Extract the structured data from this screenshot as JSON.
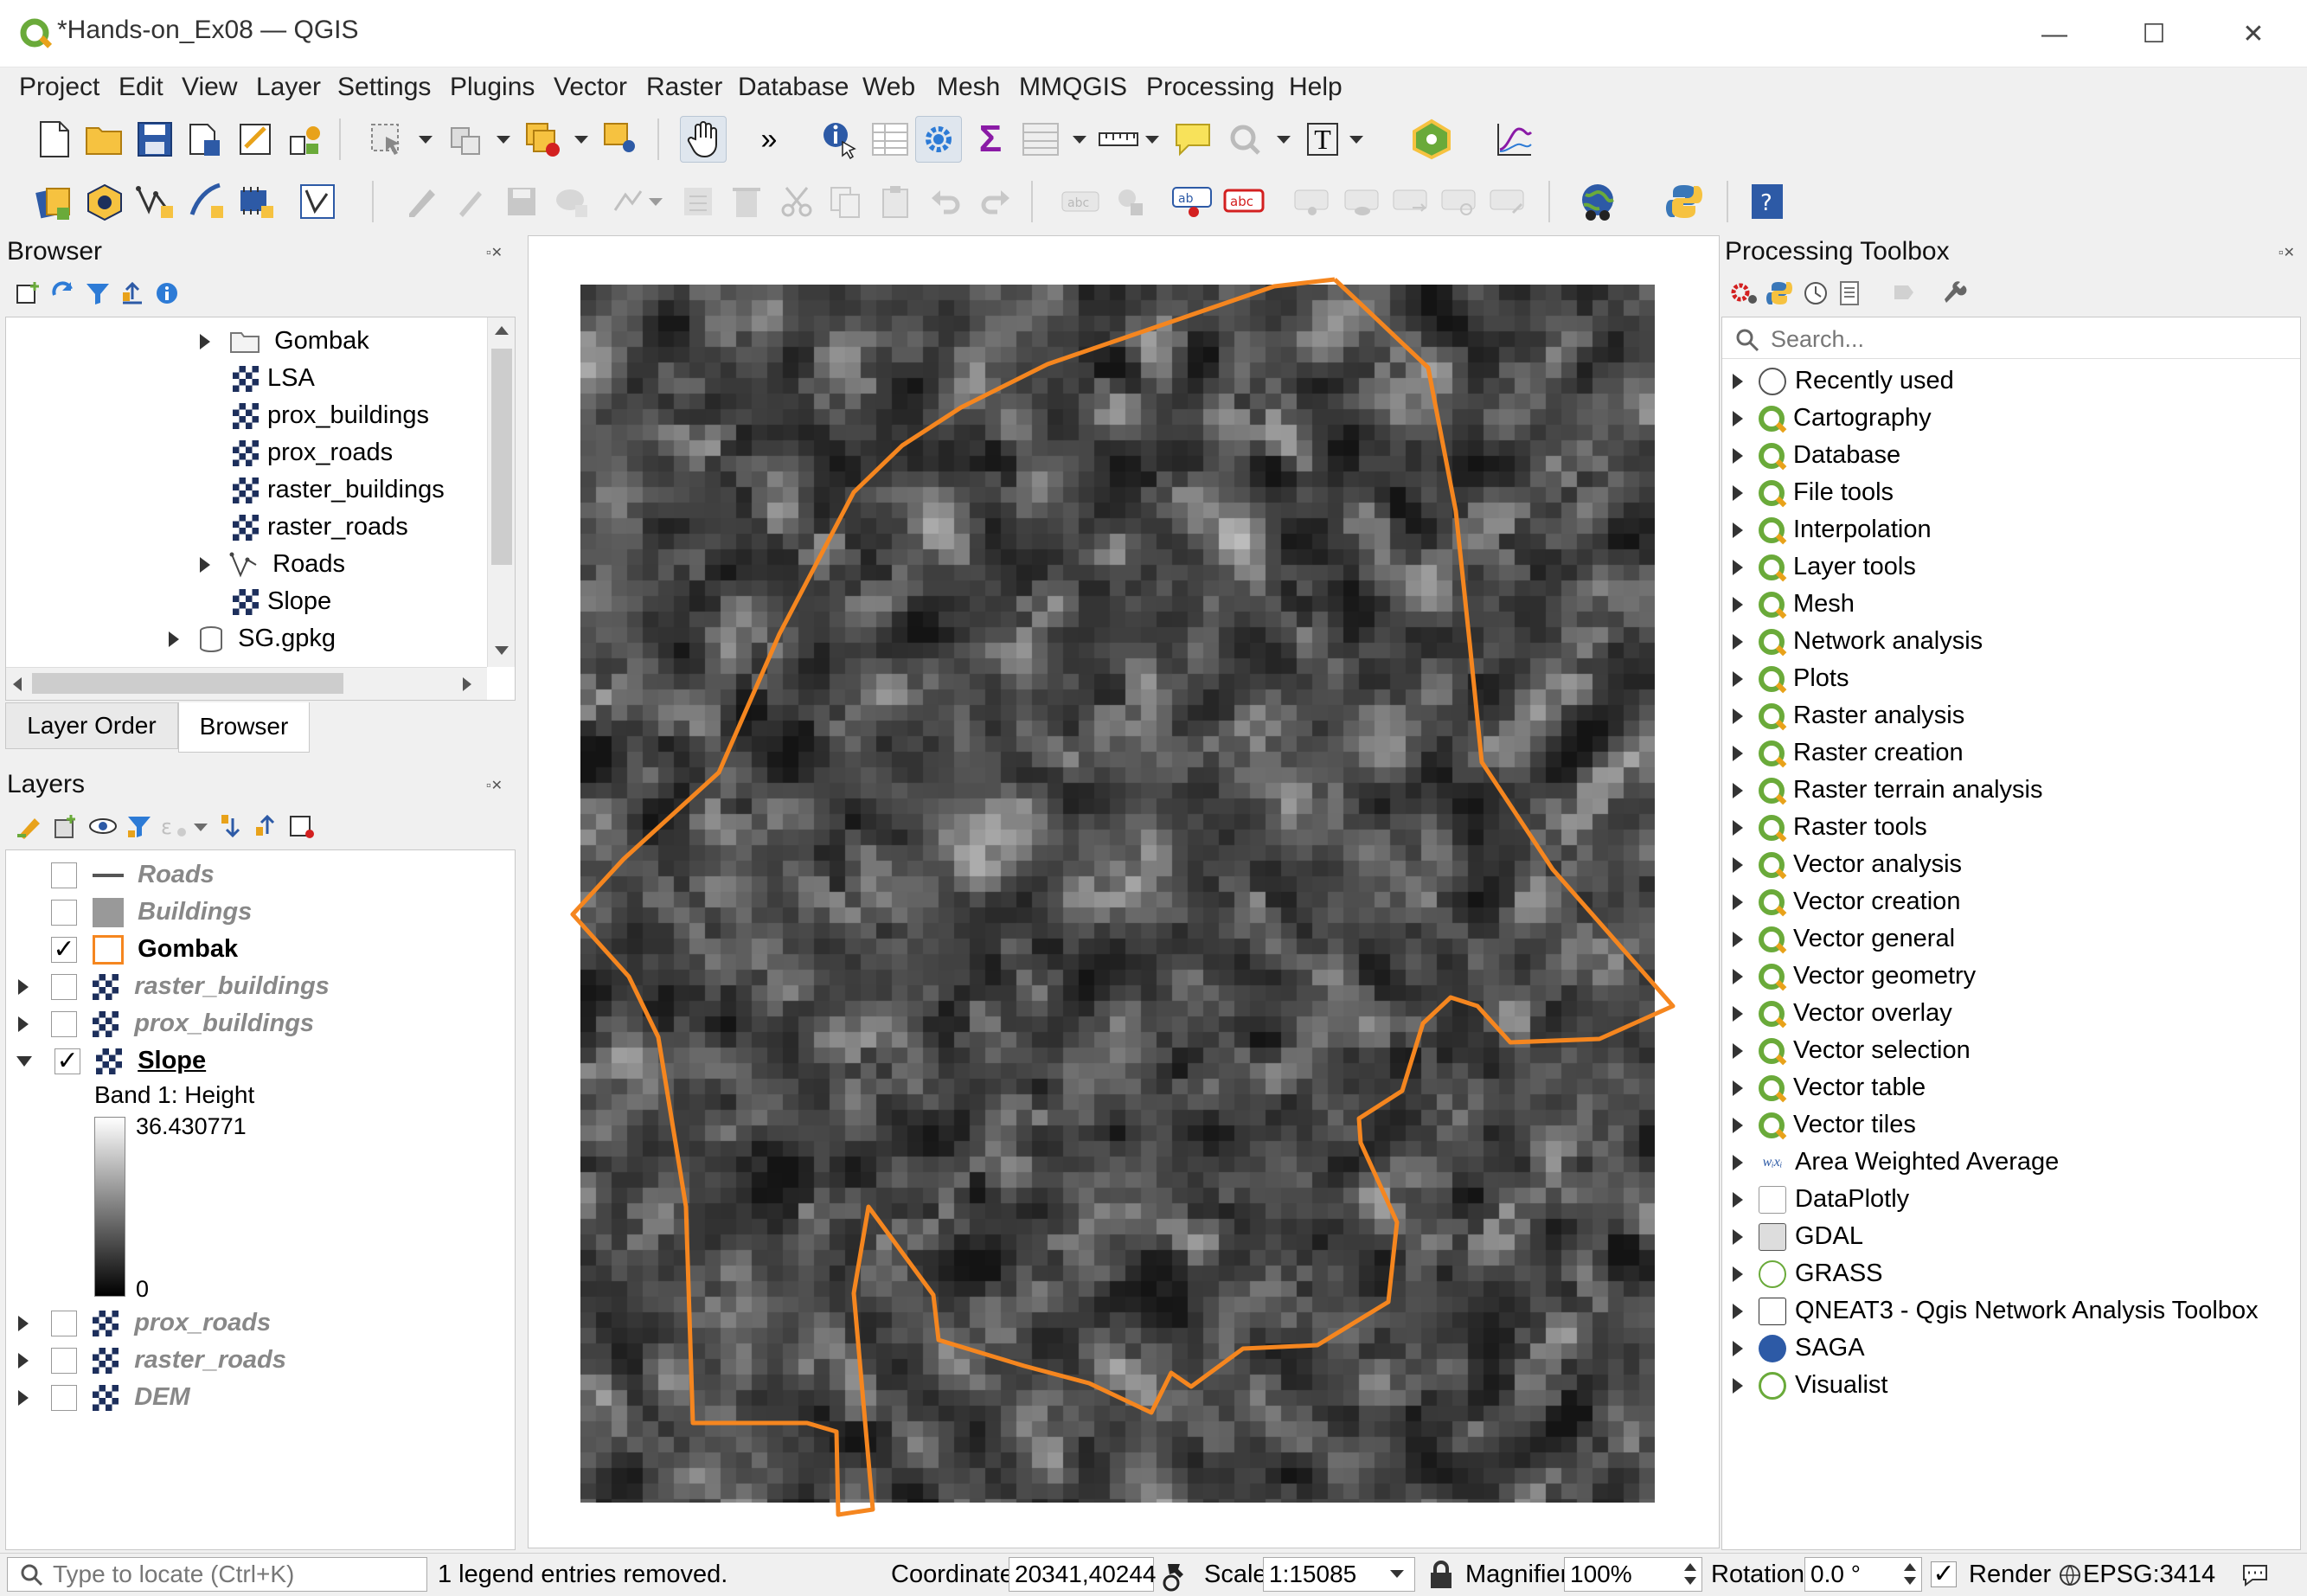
{
  "window": {
    "title": "*Hands-on_Ex08 — QGIS",
    "minimize": "—",
    "maximize": "☐",
    "close": "✕"
  },
  "menu": [
    "Project",
    "Edit",
    "View",
    "Layer",
    "Settings",
    "Plugins",
    "Vector",
    "Raster",
    "Database",
    "Web",
    "Mesh",
    "MMQGIS",
    "Processing",
    "Help"
  ],
  "toolbar": {
    "pan_icon": "hand-pan-icon",
    "more": "»",
    "sigma": "Σ",
    "text_annotation": "T"
  },
  "browser": {
    "title": "Browser",
    "items": [
      {
        "label": "Gombak",
        "icon": "folder-icon",
        "expandable": true
      },
      {
        "label": "LSA",
        "icon": "raster-icon",
        "expandable": false
      },
      {
        "label": "prox_buildings",
        "icon": "raster-icon",
        "expandable": false
      },
      {
        "label": "prox_roads",
        "icon": "raster-icon",
        "expandable": false
      },
      {
        "label": "raster_buildings",
        "icon": "raster-icon",
        "expandable": false
      },
      {
        "label": "raster_roads",
        "icon": "raster-icon",
        "expandable": false
      },
      {
        "label": "Roads",
        "icon": "line-layer-icon",
        "expandable": true
      },
      {
        "label": "Slope",
        "icon": "raster-icon",
        "expandable": false
      },
      {
        "label": "SG.gpkg",
        "icon": "database-icon",
        "expandable": true
      }
    ],
    "tabs": [
      "Layer Order",
      "Browser"
    ]
  },
  "layers": {
    "title": "Layers",
    "items": [
      {
        "label": "Roads",
        "checked": false,
        "icon": "line-icon"
      },
      {
        "label": "Buildings",
        "checked": false,
        "icon": "polygon-icon"
      },
      {
        "label": "Gombak",
        "checked": true,
        "icon": "outline-polygon-icon"
      },
      {
        "label": "raster_buildings",
        "checked": false,
        "icon": "raster-icon"
      },
      {
        "label": "prox_buildings",
        "checked": false,
        "icon": "raster-icon"
      },
      {
        "label": "Slope",
        "checked": true,
        "icon": "raster-icon"
      },
      {
        "label": "prox_roads",
        "checked": false,
        "icon": "raster-icon"
      },
      {
        "label": "raster_roads",
        "checked": false,
        "icon": "raster-icon"
      },
      {
        "label": "DEM",
        "checked": false,
        "icon": "raster-icon"
      }
    ],
    "legend": {
      "band": "Band 1: Height",
      "max": "36.430771",
      "min": "0"
    }
  },
  "toolbox": {
    "title": "Processing Toolbox",
    "search_placeholder": "Search...",
    "items": [
      "Recently used",
      "Cartography",
      "Database",
      "File tools",
      "Interpolation",
      "Layer tools",
      "Mesh",
      "Network analysis",
      "Plots",
      "Raster analysis",
      "Raster creation",
      "Raster terrain analysis",
      "Raster tools",
      "Vector analysis",
      "Vector creation",
      "Vector general",
      "Vector geometry",
      "Vector overlay",
      "Vector selection",
      "Vector table",
      "Vector tiles",
      "Area Weighted Average",
      "DataPlotly",
      "GDAL",
      "GRASS",
      "QNEAT3 - Qgis Network Analysis Toolbox",
      "SAGA",
      "Visualist"
    ]
  },
  "status": {
    "locator_placeholder": "Type to locate (Ctrl+K)",
    "message": "1 legend entries removed.",
    "coordinate_label": "Coordinate",
    "coordinate": "20341,40244",
    "scale_label": "Scale",
    "scale": "1:15085",
    "magnifier_label": "Magnifier",
    "magnifier": "100%",
    "rotation_label": "Rotation",
    "rotation": "0.0 °",
    "render_label": "Render",
    "crs": "EPSG:3414"
  },
  "colors": {
    "boundary": "#f5861f",
    "qgis_green": "#6aaa3a"
  }
}
